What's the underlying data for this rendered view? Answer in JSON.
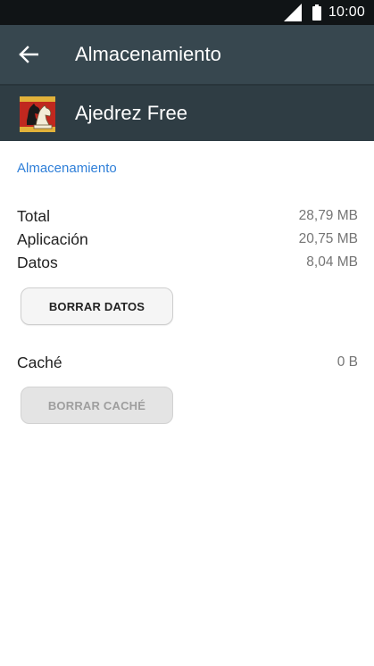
{
  "status_bar": {
    "time": "10:00"
  },
  "toolbar": {
    "title": "Almacenamiento",
    "back_icon": "arrow-back-icon"
  },
  "app": {
    "name": "Ajedrez Free",
    "icon": "chess-knight-icon"
  },
  "storage": {
    "section_title": "Almacenamiento",
    "rows": [
      {
        "label": "Total",
        "value": "28,79 MB"
      },
      {
        "label": "Aplicación",
        "value": "20,75 MB"
      },
      {
        "label": "Datos",
        "value": "8,04 MB"
      }
    ],
    "clear_data_label": "BORRAR DATOS"
  },
  "cache": {
    "label": "Caché",
    "value": "0 B",
    "clear_cache_label": "BORRAR CACHÉ",
    "clear_cache_enabled": false
  },
  "colors": {
    "toolbar": "#37474f",
    "app_header": "#2f3d44",
    "status_bar": "#101416",
    "accent": "#2f7fd8"
  }
}
